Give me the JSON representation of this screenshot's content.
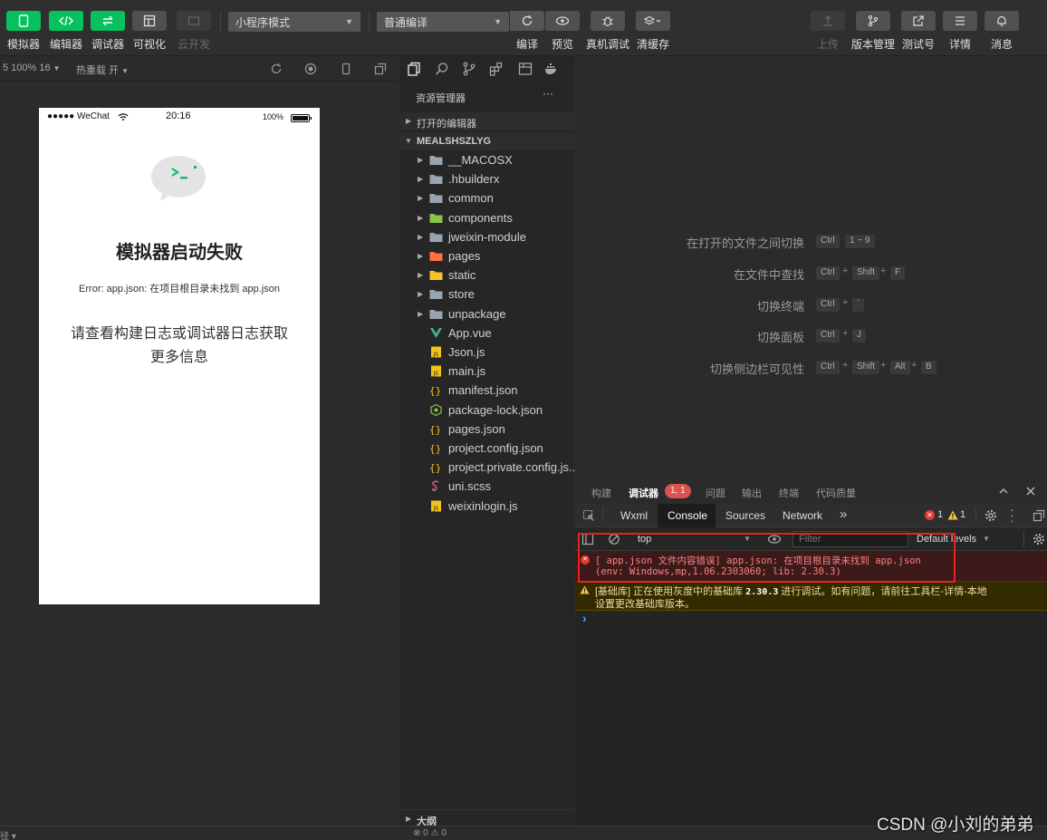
{
  "toolbar": {
    "simulator": "模拟器",
    "editor": "编辑器",
    "debugger": "调试器",
    "visual": "可视化",
    "cloud": "云开发",
    "mode": "小程序模式",
    "compile_mode": "普通编译",
    "compile": "编译",
    "preview": "预览",
    "real_debug": "真机调试",
    "clear_cache": "清缓存",
    "upload": "上传",
    "version": "版本管理",
    "test_account": "测试号",
    "details": "详情",
    "messages": "消息"
  },
  "subbar": {
    "zoom": "5 100% 16",
    "hot_reload": "热重载 开"
  },
  "phone": {
    "carrier": "●●●●● WeChat",
    "time": "20:16",
    "battery": "100%",
    "title": "模拟器启动失败",
    "error": "Error: app.json: 在项目根目录未找到 app.json",
    "hint_line1": "请查看构建日志或调试器日志获取",
    "hint_line2": "更多信息"
  },
  "explorer": {
    "title": "资源管理器",
    "more": "···",
    "open_editors": "打开的编辑器",
    "project": "MEALSHSZLYG",
    "outline": "大纲",
    "items": [
      {
        "name": "__MACOSX",
        "type": "folder",
        "color": "#9aa4b1"
      },
      {
        "name": ".hbuilderx",
        "type": "folder",
        "color": "#9aa4b1"
      },
      {
        "name": "common",
        "type": "folder",
        "color": "#9aa4b1"
      },
      {
        "name": "components",
        "type": "folder",
        "color": "#8bc34a"
      },
      {
        "name": "jweixin-module",
        "type": "folder",
        "color": "#9aa4b1"
      },
      {
        "name": "pages",
        "type": "folder",
        "color": "#ff7043"
      },
      {
        "name": "static",
        "type": "folder",
        "color": "#fbc02d"
      },
      {
        "name": "store",
        "type": "folder",
        "color": "#9aa4b1"
      },
      {
        "name": "unpackage",
        "type": "folder",
        "color": "#9aa4b1"
      },
      {
        "name": "App.vue",
        "type": "vue",
        "color": "#41b883"
      },
      {
        "name": "Json.js",
        "type": "js",
        "color": "#f0c419"
      },
      {
        "name": "main.js",
        "type": "js",
        "color": "#f0c419"
      },
      {
        "name": "manifest.json",
        "type": "json",
        "color": "#f0c419"
      },
      {
        "name": "package-lock.json",
        "type": "npm",
        "color": "#8bc34a"
      },
      {
        "name": "pages.json",
        "type": "json",
        "color": "#f0c419"
      },
      {
        "name": "project.config.json",
        "type": "json",
        "color": "#f0c419"
      },
      {
        "name": "project.private.config.js...",
        "type": "json",
        "color": "#f0c419"
      },
      {
        "name": "uni.scss",
        "type": "scss",
        "color": "#e05d8c"
      },
      {
        "name": "weixinlogin.js",
        "type": "js",
        "color": "#f0c419"
      }
    ]
  },
  "shortcuts": [
    {
      "label": "在打开的文件之间切换",
      "keys": [
        "Ctrl",
        "1 ~ 9"
      ],
      "joined": false
    },
    {
      "label": "在文件中查找",
      "keys": [
        "Ctrl",
        "Shift",
        "F"
      ],
      "joined": true
    },
    {
      "label": "切换终端",
      "keys": [
        "Ctrl",
        "`"
      ],
      "joined": true
    },
    {
      "label": "切换面板",
      "keys": [
        "Ctrl",
        "J"
      ],
      "joined": true
    },
    {
      "label": "切换侧边栏可见性",
      "keys": [
        "Ctrl",
        "Shift",
        "Alt",
        "B"
      ],
      "joined": true
    }
  ],
  "devtools": {
    "tabs": [
      "构建",
      "调试器",
      "问题",
      "输出",
      "终端",
      "代码质量"
    ],
    "badge": "1, 1",
    "subtabs": [
      "Wxml",
      "Console",
      "Sources",
      "Network"
    ],
    "more_tabs": "»",
    "error_count": "1",
    "warn_count": "1",
    "context": "top",
    "filter_placeholder": "Filter",
    "levels": "Default levels",
    "error_line1": "[ app.json 文件内容错误] app.json: 在项目根目录未找到 app.json",
    "error_line2": "(env: Windows,mp,1.06.2303060; lib: 2.30.3)",
    "warn_line1_a": "[基础库] 正在使用灰度中的基础库 ",
    "warn_line1_b": "2.30.3",
    "warn_line1_c": " 进行调试。如有问题，请前往工具栏-详情-本地",
    "warn_line2": "设置更改基础库版本。",
    "prompt": "›"
  },
  "status": {
    "errors": "⊗ 0 ⚠ 0",
    "left": "径 ▾"
  },
  "watermark": "CSDN @小刘的弟弟"
}
